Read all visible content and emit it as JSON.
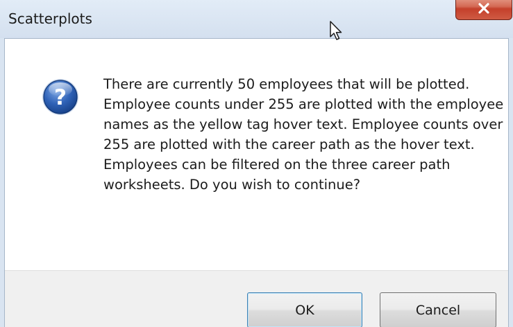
{
  "window": {
    "title": "Scatterplots",
    "close_icon": "close-icon"
  },
  "message": {
    "icon": "question-icon",
    "text": "There are currently 50 employees that will be plotted. Employee counts under 255 are plotted with the employee names as the yellow tag hover text. Employee counts over 255 are plotted with the career path as the hover text. Employees can be filtered on the three career path worksheets. Do you wish to continue?"
  },
  "buttons": {
    "ok_label": "OK",
    "cancel_label": "Cancel"
  },
  "colors": {
    "title_bar": "#d9e4f1",
    "close_button": "#c4402b",
    "icon_blue": "#1f4fa3",
    "button_bar": "#f0f0f0",
    "default_button_border": "#3c7fb1"
  }
}
